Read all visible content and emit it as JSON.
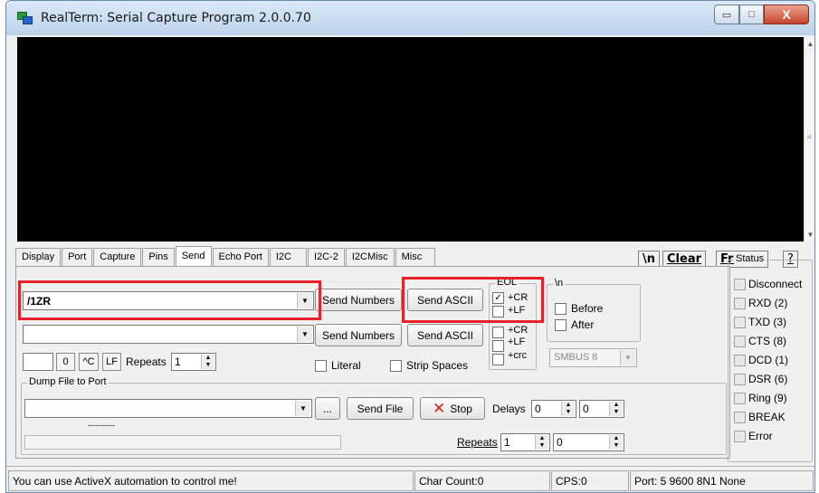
{
  "window": {
    "title": "RealTerm: Serial Capture Program 2.0.0.70"
  },
  "titlebar_buttons": {
    "minimize": "▭",
    "maximize": "□",
    "close": "X"
  },
  "tabs": [
    {
      "label": "Display"
    },
    {
      "label": "Port"
    },
    {
      "label": "Capture"
    },
    {
      "label": "Pins"
    },
    {
      "label": "Send",
      "active": true
    },
    {
      "label": "Echo Port"
    },
    {
      "label": "I2C"
    },
    {
      "label": "I2C-2"
    },
    {
      "label": "I2CMisc"
    },
    {
      "label": "Misc"
    }
  ],
  "toolbar": {
    "newline": "\\n",
    "clear": "Clear",
    "freeze": "Freeze",
    "help": "?"
  },
  "send": {
    "row1_value": "/1ZR",
    "row2_value": "",
    "send_numbers_1": "Send Numbers",
    "send_ascii_1": "Send ASCII",
    "send_numbers_2": "Send Numbers",
    "send_ascii_2": "Send ASCII",
    "eol_title": "EOL",
    "eol_cr1": "+CR",
    "eol_lf1": "+LF",
    "eol_cr2": "+CR",
    "eol_lf2": "+LF",
    "eol_crc": "+crc",
    "nl_title": "\\n",
    "before": "Before",
    "after": "After",
    "smbus": "SMBUS 8",
    "btn_zero": "0",
    "btn_ctrl": "^C",
    "btn_lf": "LF",
    "repeats_label": "Repeats",
    "repeats_value": "1",
    "literal": "Literal",
    "strip_spaces": "Strip Spaces"
  },
  "dump": {
    "title": "Dump File to Port",
    "file_value": "",
    "browse": "...",
    "send_file": "Send File",
    "stop": "Stop",
    "delays_label": "Delays",
    "delay1": "0",
    "delay2": "0",
    "progress_text": "----------",
    "repeats_label": "Repeats",
    "repeats1": "1",
    "repeats2": "0"
  },
  "status": {
    "title": "Status",
    "items": [
      "Disconnect",
      "RXD (2)",
      "TXD (3)",
      "CTS (8)",
      "DCD (1)",
      "DSR (6)",
      "Ring (9)",
      "BREAK",
      "Error"
    ]
  },
  "statusbar": {
    "message": "You can use ActiveX automation to control me!",
    "char_count": "Char Count:0",
    "cps": "CPS:0",
    "port": "Port: 5 9600 8N1 None"
  },
  "colors": {
    "highlight": "#e8202a",
    "terminal_bg": "#000000",
    "stop_icon": "#d4201c"
  }
}
